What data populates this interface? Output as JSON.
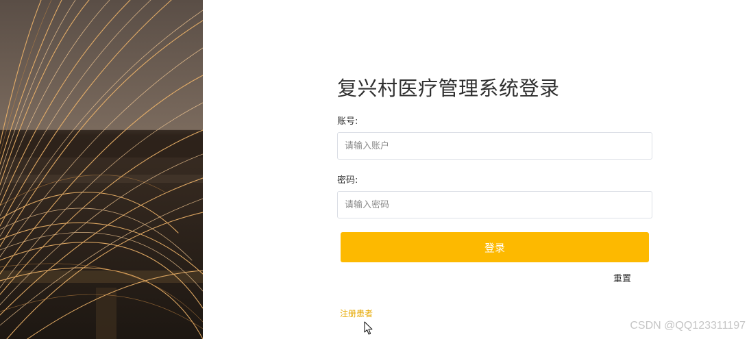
{
  "login": {
    "title": "复兴村医疗管理系统登录",
    "account_label": "账号:",
    "account_value": "",
    "account_placeholder": "请输入账户",
    "password_label": "密码:",
    "password_value": "",
    "password_placeholder": "请输入密码",
    "login_button_label": "登录",
    "reset_label": "重置",
    "register_label": "注册患者"
  },
  "watermark": "CSDN @QQ123311197",
  "colors": {
    "accent": "#fdb900",
    "register_link": "#e6a800"
  },
  "icons": {
    "cursor": "mouse-pointer-icon"
  }
}
